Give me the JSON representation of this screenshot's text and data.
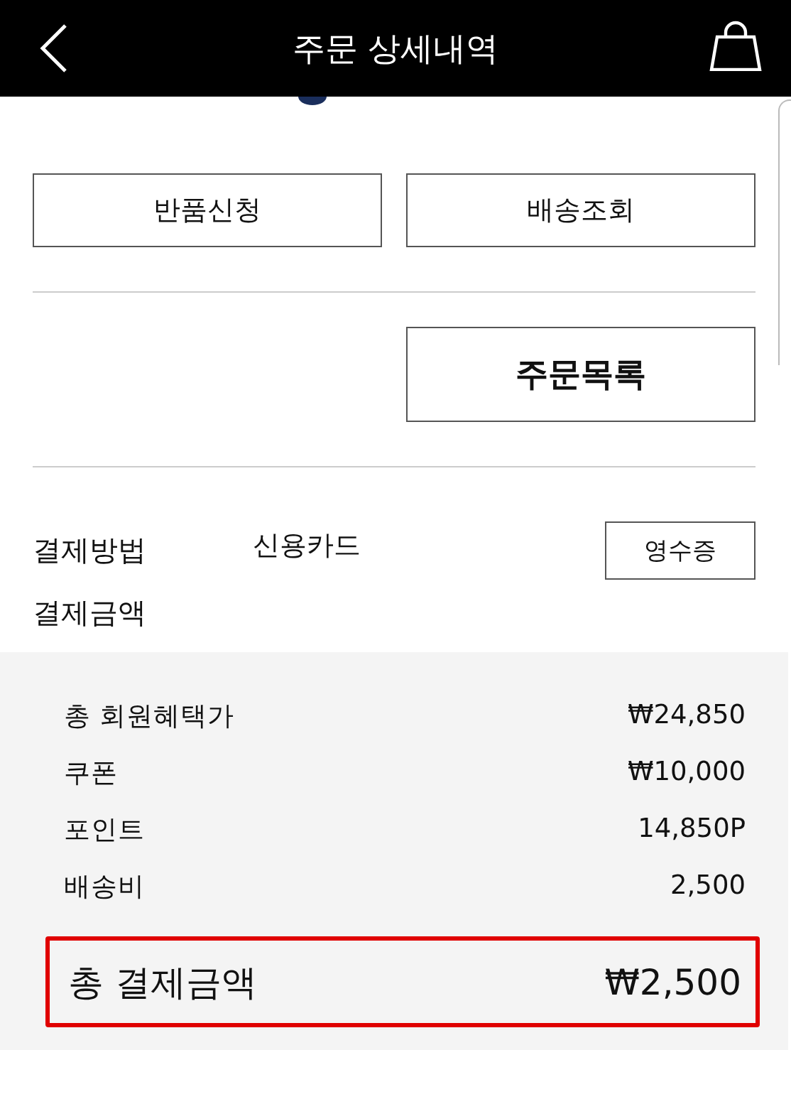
{
  "header": {
    "title": "주문 상세내역"
  },
  "order_actions": [
    {
      "label": "반품신청"
    },
    {
      "label": "배송조회"
    }
  ],
  "list_button": {
    "label": "주문목록"
  },
  "payment": {
    "method_label": "결제방법",
    "method_value": "신용카드",
    "receipt_button": "영수증",
    "amount_label": "결제금액"
  },
  "breakdown": [
    {
      "label": "총 회원혜택가",
      "value": "₩24,850"
    },
    {
      "label": "쿠폰",
      "value": "₩10,000"
    },
    {
      "label": "포인트",
      "value": "14,850P"
    },
    {
      "label": "배송비",
      "value": "2,500"
    }
  ],
  "total": {
    "label": "총 결제금액",
    "value": "₩2,500",
    "highlighted": true
  }
}
